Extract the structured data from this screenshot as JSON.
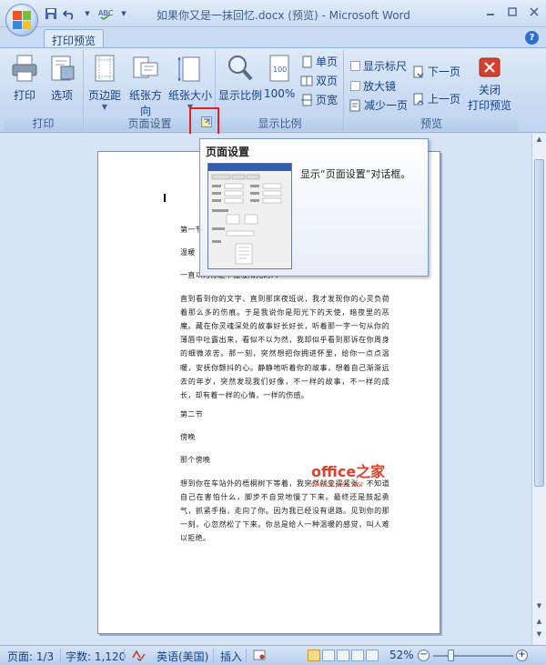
{
  "window": {
    "title": "如果你又是一抹回忆.docx (预览) - Microsoft Word",
    "controls": [
      "minimize-icon",
      "maximize-icon",
      "close-icon"
    ]
  },
  "ribbon": {
    "tab": "打印预览",
    "groups": {
      "print": {
        "label": "打印",
        "print_btn": "打印",
        "options_btn": "选项"
      },
      "page_setup": {
        "label": "页面设置",
        "margins_btn": "页边距",
        "orientation_btn": "纸张方向",
        "size_btn": "纸张大小"
      },
      "zoom": {
        "label": "显示比例",
        "zoom_btn": "显示比例",
        "hundred_btn": "100%",
        "single_page": "单页",
        "two_pages": "双页",
        "page_width": "页宽"
      },
      "preview": {
        "label": "预览",
        "show_ruler": "显示标尺",
        "magnifier": "放大镜",
        "shrink_one_page": "减少一页",
        "next_page": "下一页",
        "prev_page": "上一页",
        "close_preview_line1": "关闭",
        "close_preview_line2": "打印预览"
      }
    }
  },
  "tooltip": {
    "title": "页面设置",
    "description": "显示“页面设置”对话框。"
  },
  "document": {
    "lines": [
      "第一节",
      "温暖",
      "一直以为你是个温暖阳光的人",
      "直到看到你的文字、直到那床夜班说，我才发现你的心灵负荷着那么多的伤痕。于是我说你是阳光下的天使，暗夜里的恶魔。藏在你灵魂深处的故事好长好长，听着那一字一句从你的薄唇中吐露出来，看似不以为然，我却似乎看到那诉在你周身的细微浓苦。那一刻，突然想把你拥进怀里，给你一点点温暖，安抚你颤抖的心。静静地听着你的故事，想着自己渐渐远去的年岁，突然发现我们好像，不一样的故事，不一样的成长，却有着一样的心情，一样的伤感。",
      "第二节",
      "傍晚",
      "那个傍晚",
      "想到你在车站外的梧桐树下等着，我突然就变得紧张，不知道自己在害怕什么，脚步不自觉地慢了下来。最终还是鼓起勇气，抓紧手指，走向了你。因为我已经没有退路。见到你的那一刻，心忽然松了下来。你总是给人一种温暖的感觉，叫人难以拒绝。"
    ],
    "watermark_main": "office之家",
    "watermark_sub": "OFFICE.JB51.NET"
  },
  "statusbar": {
    "page": "页面: 1/3",
    "words": "字数: 1,120",
    "language": "英语(美国)",
    "insert": "插入",
    "zoom": "52%",
    "zoom_level_percent": 52
  }
}
